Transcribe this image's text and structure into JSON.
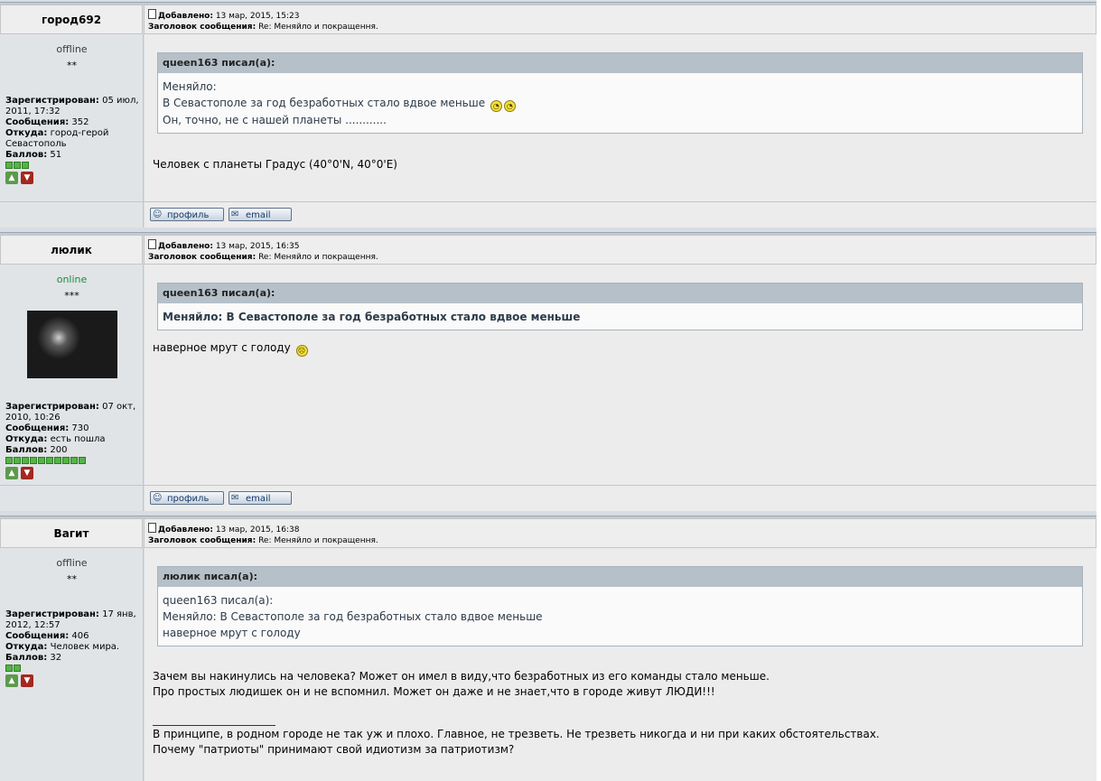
{
  "posts": [
    {
      "author": "город692",
      "status": "offline",
      "status_color": "#3a3a3a",
      "rank_stars": "**",
      "date_label": "Добавлено:",
      "date": "13 мар, 2015, 15:23",
      "subject_label": "Заголовок сообщения:",
      "subject": "Re: Меняйло и покращення.",
      "registered_label": "Зарегистрирован:",
      "registered": "05 июл, 2011, 17:32",
      "messages_label": "Сообщения:",
      "messages": "352",
      "from_label": "Откуда:",
      "from": "город-герой Севастополь",
      "points_label": "Баллов:",
      "points": "51",
      "pip_count": 3,
      "quote_header": "queen163 писал(а):",
      "quote_lines": [
        "Меняйло:",
        "В Севастополе за год безработных стало вдвое меньше",
        "Он, точно, не с нашей планеты ............"
      ],
      "message_lines": [
        "Человек с планеты Градус (40°0'N, 40°0'E)"
      ],
      "profile_btn": "профиль",
      "email_btn": "email"
    },
    {
      "author": "люлик",
      "status": "online",
      "status_color": "#1e8a3c",
      "rank_stars": "***",
      "date_label": "Добавлено:",
      "date": "13 мар, 2015, 16:35",
      "subject_label": "Заголовок сообщения:",
      "subject": "Re: Меняйло и покращення.",
      "registered_label": "Зарегистрирован:",
      "registered": "07 окт, 2010, 10:26",
      "messages_label": "Сообщения:",
      "messages": "730",
      "from_label": "Откуда:",
      "from": "есть пошла",
      "points_label": "Баллов:",
      "points": "200",
      "pip_count": 10,
      "quote_header": "queen163 писал(а):",
      "quote_lines": [
        "Меняйло: В Севастополе за год безработных стало вдвое меньше"
      ],
      "message_lines": [
        "наверное мрут с голоду"
      ],
      "profile_btn": "профиль",
      "email_btn": "email"
    },
    {
      "author": "Вагит",
      "status": "offline",
      "status_color": "#3a3a3a",
      "rank_stars": "**",
      "date_label": "Добавлено:",
      "date": "13 мар, 2015, 16:38",
      "subject_label": "Заголовок сообщения:",
      "subject": "Re: Меняйло и покращення.",
      "registered_label": "Зарегистрирован:",
      "registered": "17 янв, 2012, 12:57",
      "messages_label": "Сообщения:",
      "messages": "406",
      "from_label": "Откуда:",
      "from": "Человек мира.",
      "points_label": "Баллов:",
      "points": "32",
      "pip_count": 2,
      "quote_header": "люлик писал(а):",
      "quote_lines": [
        "queen163 писал(а):",
        "Меняйло: В Севастополе за год безработных стало вдвое меньше",
        "наверное мрут с голоду"
      ],
      "message_lines": [
        "Зачем вы накинулись на человека? Может он имел в виду,что безработных из его команды стало меньше.",
        "Про простых людишек он и не вспомнил. Может он даже и не знает,что в городе живут ЛЮДИ!!!"
      ],
      "signature_lines": [
        "В принципе, в родном городе не так уж и плохо. Главное, не трезветь. Не трезветь никогда и ни при каких обстоятельствах.",
        "Почему \"патриоты\" принимают свой идиотизм за патриотизм?"
      ]
    }
  ],
  "icons": {
    "post_icon": "document-icon",
    "vote_up": "thumbs-up-icon",
    "vote_down": "thumbs-down-icon",
    "smiley_rolleyes": "rolleyes-smiley-icon",
    "smiley_sad": "sad-smiley-icon"
  }
}
